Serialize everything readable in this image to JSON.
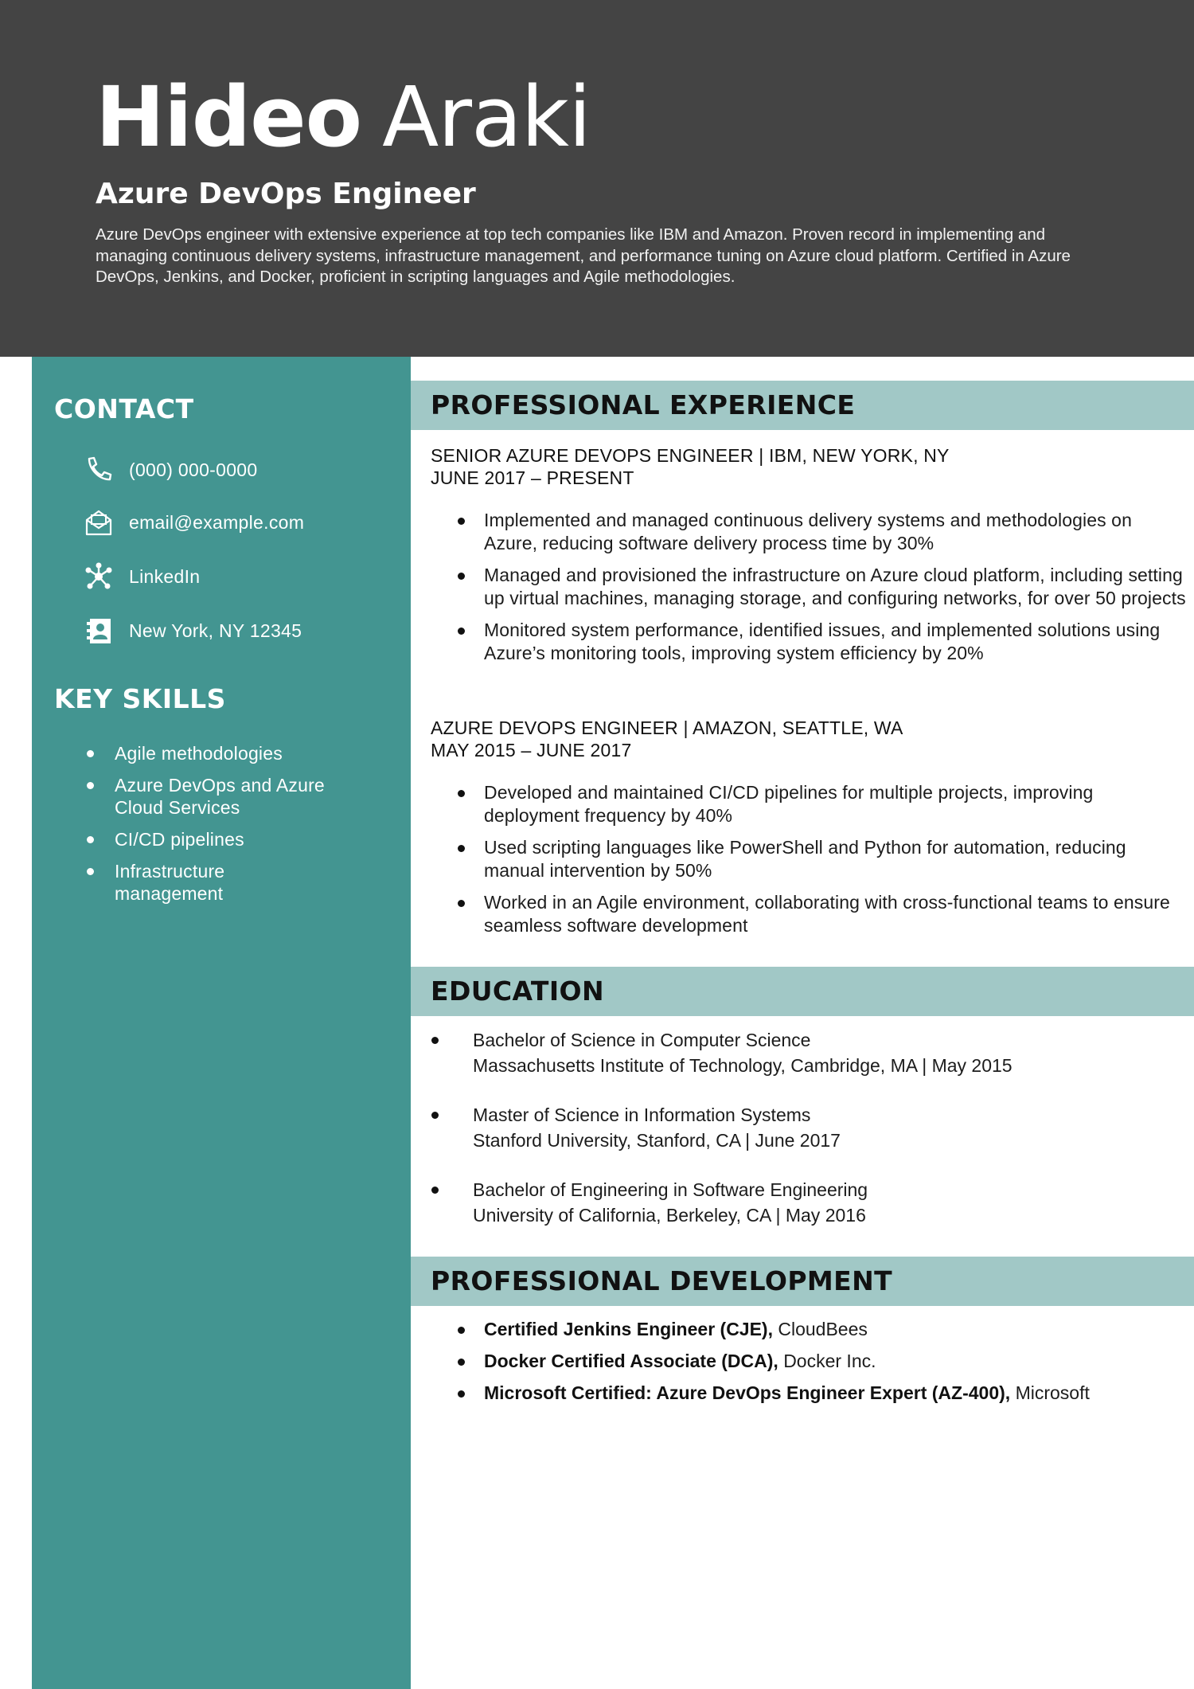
{
  "header": {
    "first_name": "Hideo",
    "last_name": "Araki",
    "title": "Azure DevOps Engineer",
    "summary": "Azure DevOps engineer with extensive experience at top tech companies like IBM and Amazon. Proven record in implementing and managing continuous delivery systems, infrastructure management, and performance tuning on Azure cloud platform. Certified in Azure DevOps, Jenkins, and Docker, proficient in scripting languages and Agile methodologies."
  },
  "sidebar": {
    "contact_heading": "CONTACT",
    "contact": [
      {
        "icon": "phone-icon",
        "text": "(000) 000-0000"
      },
      {
        "icon": "email-icon",
        "text": "email@example.com"
      },
      {
        "icon": "linkedin-network-icon",
        "text": "LinkedIn"
      },
      {
        "icon": "address-card-icon",
        "text": "New York, NY 12345"
      }
    ],
    "skills_heading": "KEY SKILLS",
    "skills": [
      "Agile methodologies",
      "Azure DevOps and Azure Cloud Services",
      "CI/CD pipelines",
      "Infrastructure management"
    ]
  },
  "experience": {
    "heading": "PROFESSIONAL EXPERIENCE",
    "jobs": [
      {
        "title_line": "SENIOR AZURE DEVOPS ENGINEER | IBM, NEW YORK, NY",
        "dates": "JUNE 2017 – PRESENT",
        "bullets": [
          "Implemented and managed continuous delivery systems and methodologies on Azure, reducing software delivery process time by 30%",
          "Managed and provisioned the infrastructure on Azure cloud platform, including setting up virtual machines, managing storage, and configuring networks, for over 50 projects",
          "Monitored system performance, identified issues, and implemented solutions using Azure’s monitoring tools, improving system efficiency by 20%"
        ]
      },
      {
        "title_line": "AZURE DEVOPS ENGINEER | AMAZON, SEATTLE, WA",
        "dates": "MAY 2015 – JUNE 2017",
        "bullets": [
          "Developed and maintained CI/CD pipelines for multiple projects, improving deployment frequency by 40%",
          "Used scripting languages like PowerShell and Python for automation, reducing manual intervention by 50%",
          "Worked in an Agile environment, collaborating with cross-functional teams to ensure seamless software development"
        ]
      }
    ]
  },
  "education": {
    "heading": "EDUCATION",
    "items": [
      {
        "degree": "Bachelor of Science in Computer Science",
        "school": "Massachusetts Institute of Technology, Cambridge, MA | May 2015"
      },
      {
        "degree": "Master of Science in Information Systems",
        "school": "Stanford University, Stanford, CA | June 2017"
      },
      {
        "degree": "Bachelor of Engineering in Software Engineering",
        "school": "University of California, Berkeley, CA | May 2016"
      }
    ]
  },
  "development": {
    "heading": "PROFESSIONAL DEVELOPMENT",
    "items": [
      {
        "cert": "Certified Jenkins Engineer (CJE),",
        "issuer": "CloudBees"
      },
      {
        "cert": "Docker Certified Associate (DCA),",
        "issuer": "Docker Inc."
      },
      {
        "cert": "Microsoft Certified: Azure DevOps Engineer Expert (AZ-400),",
        "issuer": "Microsoft"
      }
    ]
  },
  "colors": {
    "header_bg": "#444444",
    "sidebar_bg": "#439591",
    "section_band": "#a1c8c6"
  }
}
